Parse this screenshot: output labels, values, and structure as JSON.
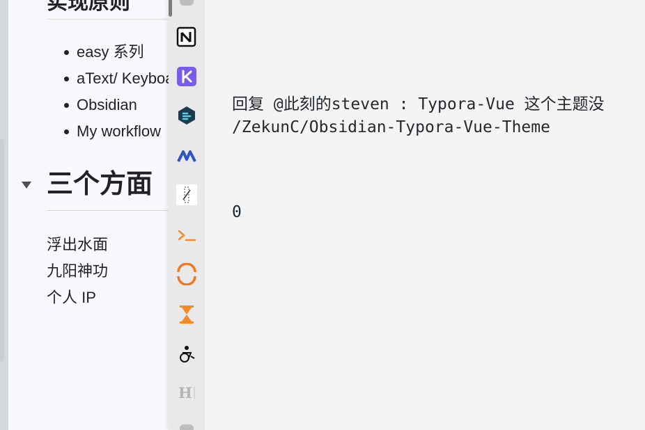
{
  "doc": {
    "partial_heading": "实现原则",
    "bullets": [
      "easy 系列",
      "aText/ Keyboard",
      "Obsidian",
      "My workflow"
    ],
    "heading": "三个方面",
    "paragraphs": [
      "浮出水面",
      "九阳神功",
      "个人 IP"
    ]
  },
  "dock": {
    "icons": [
      "notion-icon",
      "kite-icon",
      "dashboard-icon",
      "mi-icon",
      "pencil-icon",
      "terminal-icon",
      "arc-icon",
      "hourglass-icon",
      "accessibility-icon",
      "heading-icon"
    ]
  },
  "content": {
    "reply_line1": "回复 @此刻的steven : Typora-Vue 这个主题没",
    "reply_line2": "/ZekunC/Obsidian-Typora-Vue-Theme",
    "count": "0"
  }
}
